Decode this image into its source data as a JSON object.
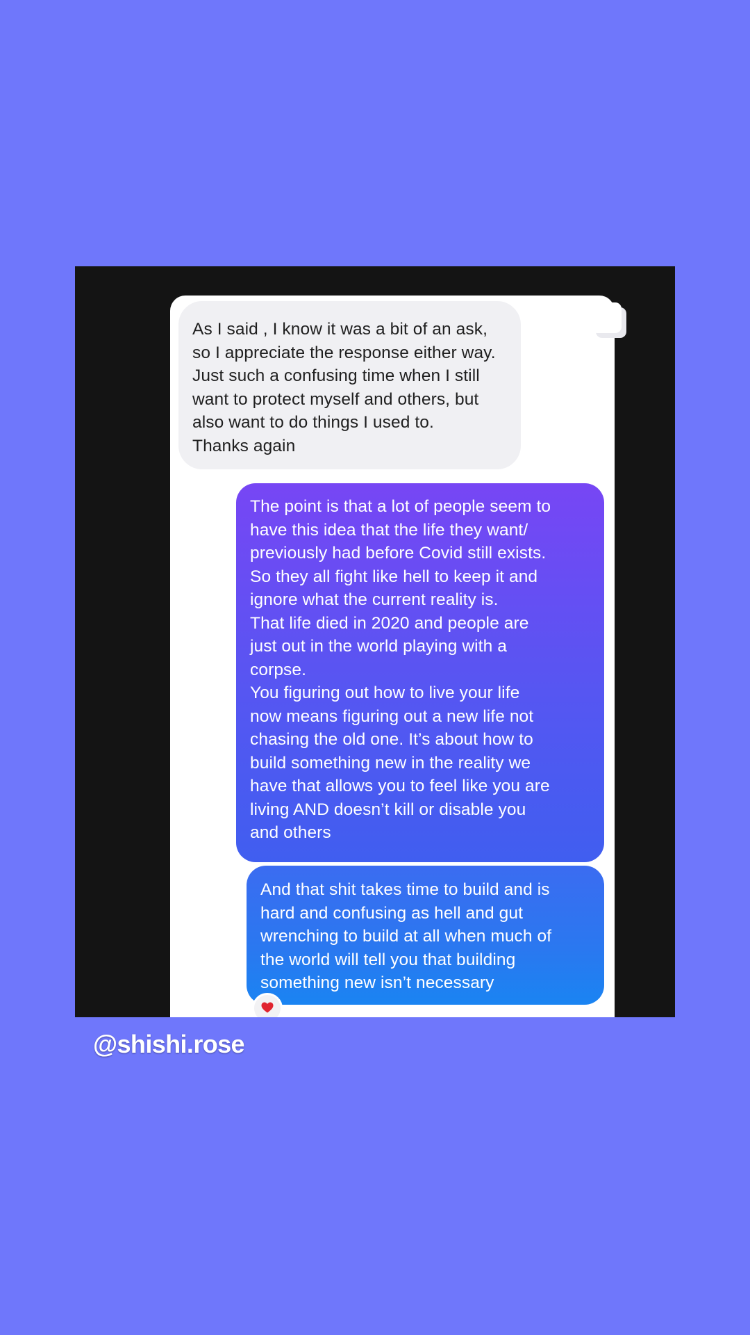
{
  "messages": {
    "incoming": [
      {
        "lines": [
          "As I said , I know it was a bit of an ask,",
          "so I appreciate the response either way.",
          "Just such a confusing time when I still",
          "want to protect myself and others, but",
          "also want to do things I used to.",
          "Thanks again"
        ]
      }
    ],
    "outgoing": [
      {
        "lines": [
          "The point is that a lot of people seem to",
          "have this idea that the life they want/",
          "previously had before Covid still exists.",
          "So they all fight like hell to keep it and",
          "ignore what the current reality is.",
          "That life died in 2020 and people are",
          "just out in the world playing with a",
          "corpse.",
          "You figuring out how to live your life",
          "now means figuring out a new life not",
          "chasing the old one. It’s about how to",
          "build something new in the reality we",
          "have that allows you to feel like you are",
          "living AND doesn’t kill or disable you",
          "and others"
        ]
      },
      {
        "lines": [
          "And that shit takes time to build and is",
          "hard and confusing as hell and gut",
          "wrenching to build at all when much of",
          "the world will tell you that building",
          "something new isn’t necessary"
        ],
        "reaction": "heart-icon"
      }
    ]
  },
  "overlay": {
    "handle": "@shishi.rose",
    "corner_icon": "copy-stack-icon"
  },
  "colors": {
    "background": "#6f77fb",
    "frame": "#141414",
    "incoming_bubble": "#f0f0f3",
    "outgoing_top": "#7746f4",
    "outgoing_bottom": "#1a84f2",
    "heart": "#e0242f"
  }
}
